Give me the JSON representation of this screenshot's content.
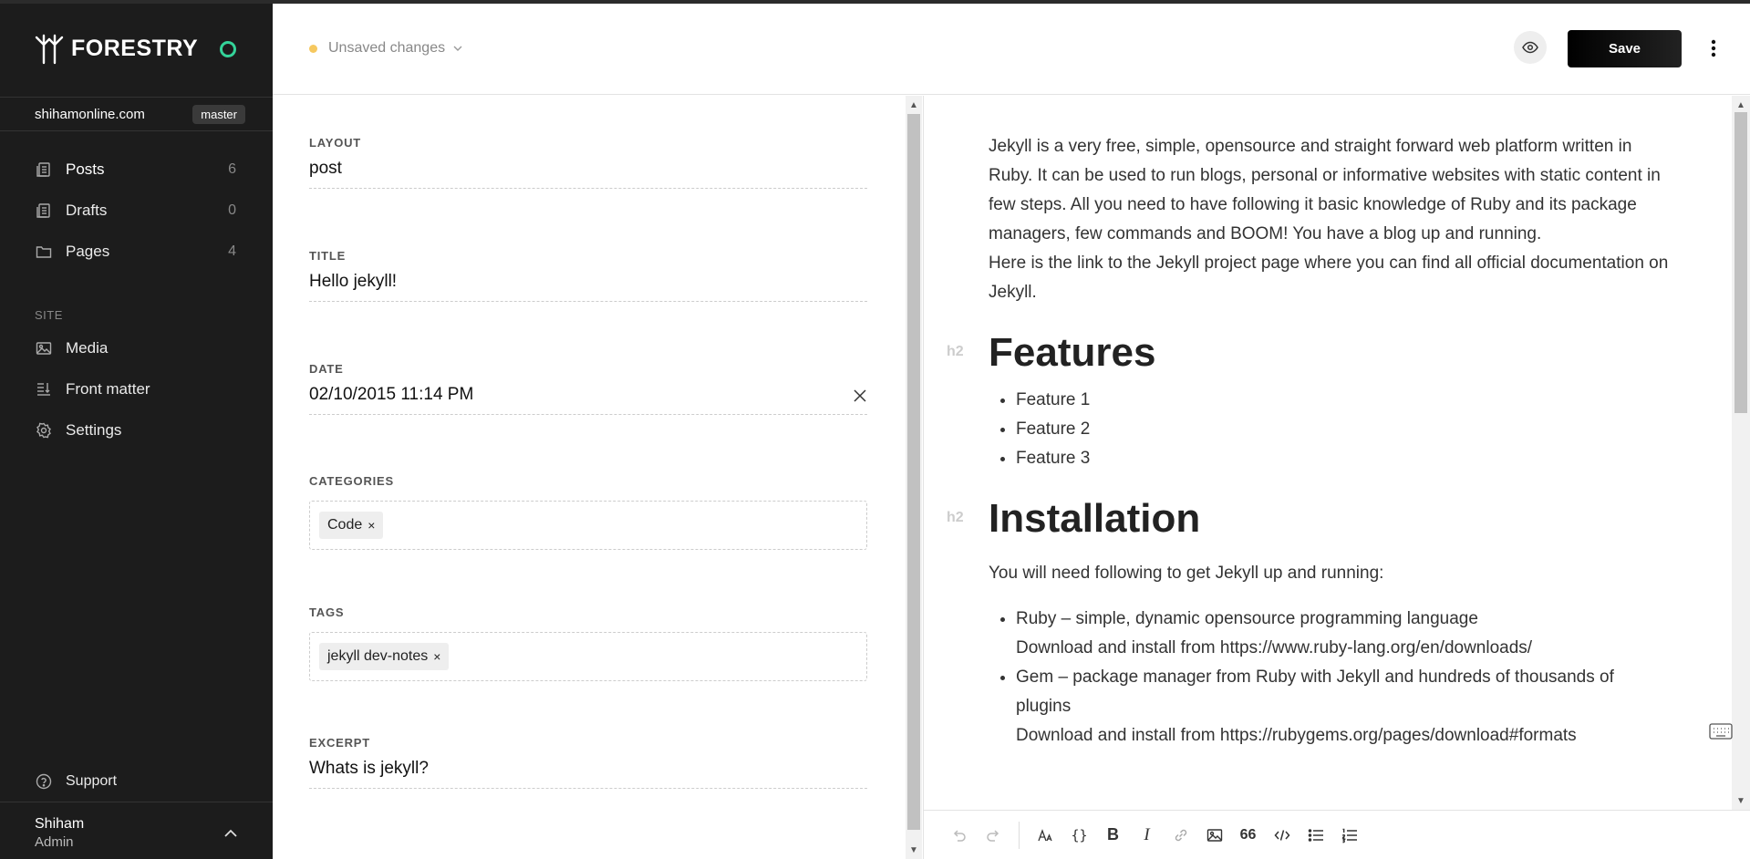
{
  "brand": {
    "name": "FORESTRY"
  },
  "site": {
    "name": "shihamonline.com",
    "branch": "master"
  },
  "nav": {
    "items": [
      {
        "label": "Posts",
        "count": "6"
      },
      {
        "label": "Drafts",
        "count": "0"
      },
      {
        "label": "Pages",
        "count": "4"
      }
    ],
    "site_section_label": "SITE",
    "site_items": [
      {
        "label": "Media"
      },
      {
        "label": "Front matter"
      },
      {
        "label": "Settings"
      }
    ],
    "support_label": "Support"
  },
  "user": {
    "name": "Shiham",
    "role": "Admin"
  },
  "header": {
    "status_text": "Unsaved changes",
    "save_label": "Save"
  },
  "front_matter": {
    "layout": {
      "label": "LAYOUT",
      "value": "post"
    },
    "title": {
      "label": "TITLE",
      "value": "Hello jekyll!"
    },
    "date": {
      "label": "DATE",
      "value": "02/10/2015 11:14 PM"
    },
    "categories": {
      "label": "CATEGORIES",
      "chips": [
        "Code"
      ]
    },
    "tags": {
      "label": "TAGS",
      "chips": [
        "jekyll dev-notes"
      ]
    },
    "excerpt": {
      "label": "EXCERPT",
      "value": "Whats is jekyll?"
    }
  },
  "editor": {
    "intro": "Jekyll is a very free, simple, opensource and straight forward web platform written in Ruby. It can be used to run blogs, personal or informative websites with static content in few steps. All you need to have following it basic knowledge of Ruby and its package managers, few commands and BOOM! You have a blog up and running.",
    "link_line": "Here is the link to the Jekyll project page  where you can find all official documentation on Jekyll.",
    "h2_marker": "h2",
    "features_heading": "Features",
    "features": [
      "Feature 1",
      "Feature 2",
      "Feature 3"
    ],
    "installation_heading": "Installation",
    "installation_intro": "You will need following to get Jekyll up and running:",
    "install_items": [
      {
        "title": "Ruby – simple, dynamic opensource programming language",
        "sub": "Download and install from https://www.ruby-lang.org/en/downloads/"
      },
      {
        "title": "Gem – package manager from Ruby with Jekyll and hundreds of thousands of plugins",
        "sub": "Download and install from https://rubygems.org/pages/download#formats"
      }
    ]
  },
  "toolbar": {
    "quote_label": "66",
    "code_label": "{}"
  },
  "colors": {
    "sidebar_bg": "#1c1c1c",
    "status_ring": "#34d399",
    "unsaved_dot": "#f6c85f",
    "save_bg": "#000000"
  }
}
